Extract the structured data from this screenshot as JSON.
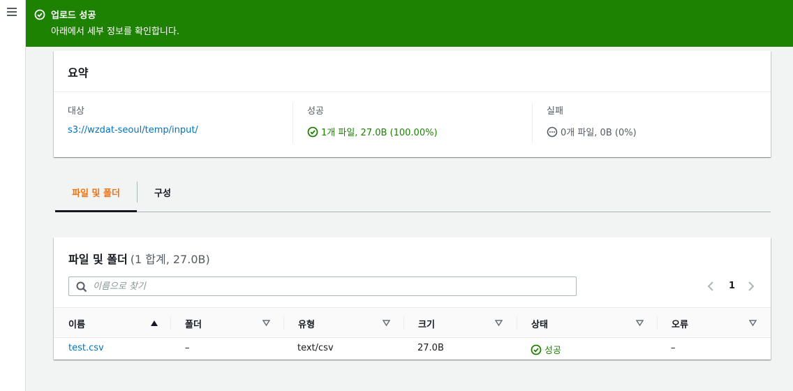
{
  "flash": {
    "title": "업로드 성공",
    "message": "아래에서 세부 정보를 확인합니다.",
    "color": "#1d8102"
  },
  "summary": {
    "title": "요약",
    "destination_label": "대상",
    "destination_value": "s3://wzdat-seoul/temp/input/",
    "success_label": "성공",
    "success_value": "1개 파일, 27.0B (100.00%)",
    "failed_label": "실패",
    "failed_value": "0개 파일, 0B (0%)"
  },
  "tabs": [
    {
      "label": "파일 및 폴더",
      "active": true
    },
    {
      "label": "구성",
      "active": false
    }
  ],
  "files": {
    "title": "파일 및 폴더",
    "count": "(1 합계, 27.0B)",
    "search_placeholder": "이름으로 찾기",
    "page": "1",
    "columns": [
      "이름",
      "폴더",
      "유형",
      "크기",
      "상태",
      "오류"
    ],
    "rows": [
      {
        "name": "test.csv",
        "folder": "–",
        "type": "text/csv",
        "size": "27.0B",
        "status": "성공",
        "error": "–"
      }
    ]
  },
  "icons": {
    "menu": "hamburger-icon",
    "flash": "check-circle-icon",
    "search": "search-icon",
    "prev": "chevron-left-icon",
    "next": "chevron-right-icon",
    "sort_asc": "sort-ascending-icon",
    "sort": "sort-icon",
    "success": "check-circle-icon",
    "neutral": "ellipsis-circle-icon"
  }
}
